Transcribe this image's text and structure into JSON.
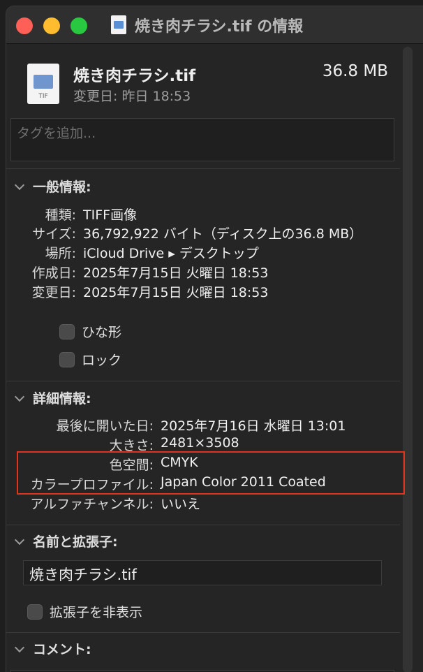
{
  "window": {
    "title": "焼き肉チラシ.tif の情報"
  },
  "file": {
    "name": "焼き肉チラシ.tif",
    "size": "36.8 MB",
    "modified": "変更日: 昨日 18:53",
    "icon_ext": "TIF"
  },
  "tags": {
    "placeholder": "タグを追加..."
  },
  "general": {
    "heading": "一般情報:",
    "rows": [
      {
        "label": "種類:",
        "value": "TIFF画像"
      },
      {
        "label": "サイズ:",
        "value": "36,792,922 バイト（ディスク上の36.8 MB）"
      },
      {
        "label": "場所:",
        "value": "iCloud Drive ▸ デスクトップ"
      },
      {
        "label": "作成日:",
        "value": "2025年7月15日 火曜日 18:53"
      },
      {
        "label": "変更日:",
        "value": "2025年7月15日 火曜日 18:53"
      }
    ],
    "stationery_label": "ひな形",
    "locked_label": "ロック"
  },
  "details": {
    "heading": "詳細情報:",
    "rows": [
      {
        "label": "最後に開いた日:",
        "value": "2025年7月16日 水曜日 13:01"
      },
      {
        "label": "大きさ:",
        "value": "2481×3508"
      },
      {
        "label": "色空間:",
        "value": "CMYK"
      },
      {
        "label": "カラープロファイル:",
        "value": "Japan Color 2011 Coated"
      },
      {
        "label": "アルファチャンネル:",
        "value": "いいえ"
      }
    ]
  },
  "name_ext": {
    "heading": "名前と拡張子:",
    "value": "焼き肉チラシ.tif",
    "hide_ext_label": "拡張子を非表示"
  },
  "comments": {
    "heading": "コメント:"
  },
  "colors": {
    "highlight": "#e3321f"
  }
}
